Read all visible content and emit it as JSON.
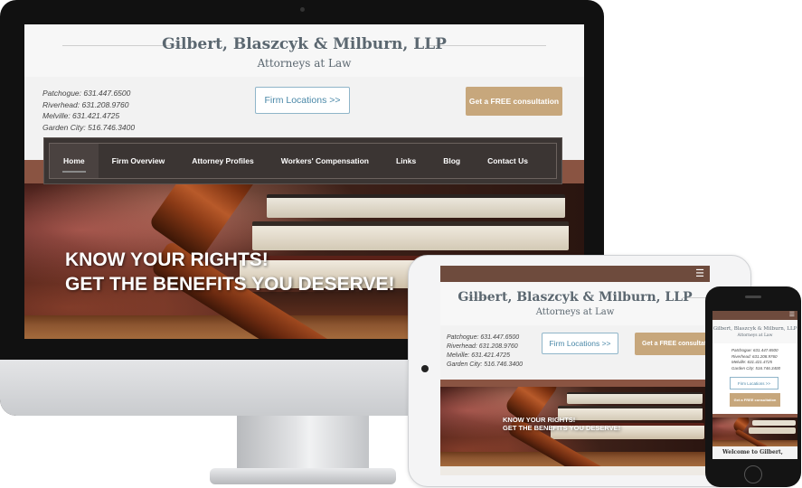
{
  "firm": {
    "name": "Gilbert, Blaszcyk & Milburn, LLP",
    "tagline": "Attorneys at Law"
  },
  "phones": [
    "Patchogue: 631.447.6500",
    "Riverhead: 631.208.9760",
    "Melville: 631.421.4725",
    "Garden City: 516.746.3400"
  ],
  "buttons": {
    "locations": "Firm Locations >>",
    "consult": "Get a FREE consultation"
  },
  "nav": {
    "items": [
      "Home",
      "Firm Overview",
      "Attorney Profiles",
      "Workers' Compensation",
      "Links",
      "Blog",
      "Contact Us"
    ],
    "active": "Home"
  },
  "hero": {
    "line1": "KNOW  YOUR RIGHTS!",
    "line2": "GET THE BENEFITS YOU DESERVE!"
  },
  "mobile": {
    "welcome": "Welcome to Gilbert,"
  },
  "colors": {
    "accent_brown": "#8a5442",
    "nav_dark": "#3b3533",
    "cta_tan": "#c7a77c",
    "link_blue": "#4a88a8",
    "title_gray": "#5b6770"
  },
  "icons": {
    "menu": "hamburger-menu-icon"
  }
}
